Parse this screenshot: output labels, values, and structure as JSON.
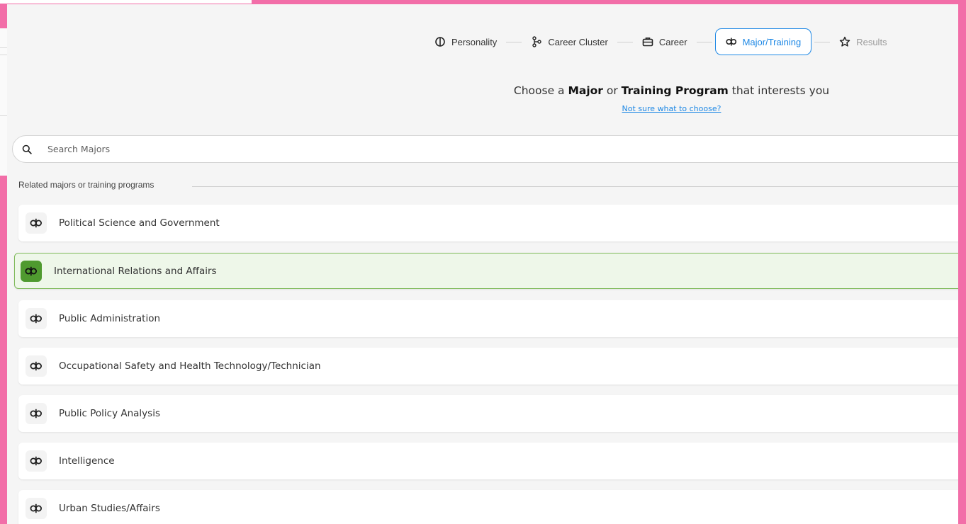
{
  "stepper": {
    "steps": [
      {
        "label": "Personality",
        "icon": "brain-icon",
        "state": "default"
      },
      {
        "label": "Career Cluster",
        "icon": "cluster-icon",
        "state": "default"
      },
      {
        "label": "Career",
        "icon": "briefcase-icon",
        "state": "default"
      },
      {
        "label": "Major/Training",
        "icon": "major-icon",
        "state": "active"
      },
      {
        "label": "Results",
        "icon": "star-icon",
        "state": "disabled"
      }
    ]
  },
  "prompt": {
    "prefix": "Choose a ",
    "bold1": "Major",
    "middle": " or ",
    "bold2": "Training Program",
    "suffix": " that interests you",
    "help_link": "Not sure what to choose?"
  },
  "search": {
    "placeholder": "Search Majors",
    "value": ""
  },
  "section": {
    "label": "Related majors or training programs"
  },
  "majors": [
    {
      "label": "Political Science and Government",
      "selected": false
    },
    {
      "label": "International Relations and Affairs",
      "selected": true
    },
    {
      "label": "Public Administration",
      "selected": false
    },
    {
      "label": "Occupational Safety and Health Technology/Technician",
      "selected": false
    },
    {
      "label": "Public Policy Analysis",
      "selected": false
    },
    {
      "label": "Intelligence",
      "selected": false
    },
    {
      "label": "Urban Studies/Affairs",
      "selected": false
    }
  ],
  "colors": {
    "accent": "#1e88e5",
    "selected_bg": "#eef7e9",
    "selected_border": "#7fba5a",
    "selected_icon_bg": "#4f9a2f",
    "frame": "#f26ea8"
  }
}
